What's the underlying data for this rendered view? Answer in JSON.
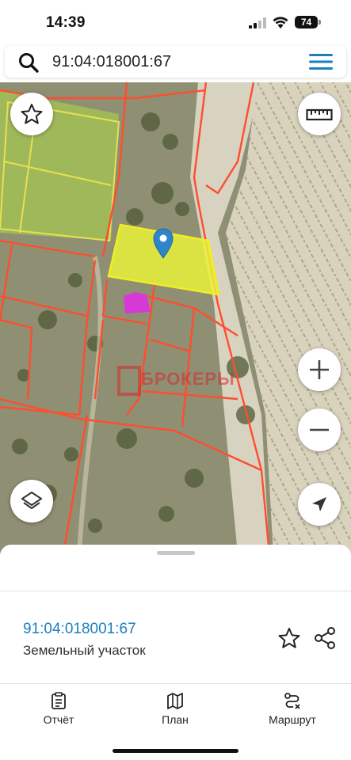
{
  "status_bar": {
    "time": "14:39",
    "battery": "74"
  },
  "search": {
    "value": "91:04:018001:67"
  },
  "map": {
    "watermark": "БРОКЕРЫ",
    "highlight_color": "#e9f23a",
    "boundary_color": "#ff4d2e",
    "marker_color": "#2e86c9"
  },
  "parcel": {
    "cadastral_number": "91:04:018001:67",
    "type": "Земельный участок"
  },
  "tabs": [
    {
      "label": "Отчёт",
      "icon": "report-icon"
    },
    {
      "label": "План",
      "icon": "map-plan-icon"
    },
    {
      "label": "Маршрут",
      "icon": "route-icon"
    }
  ],
  "colors": {
    "accent": "#1a7fc0",
    "menu": "#1a7fc0"
  }
}
